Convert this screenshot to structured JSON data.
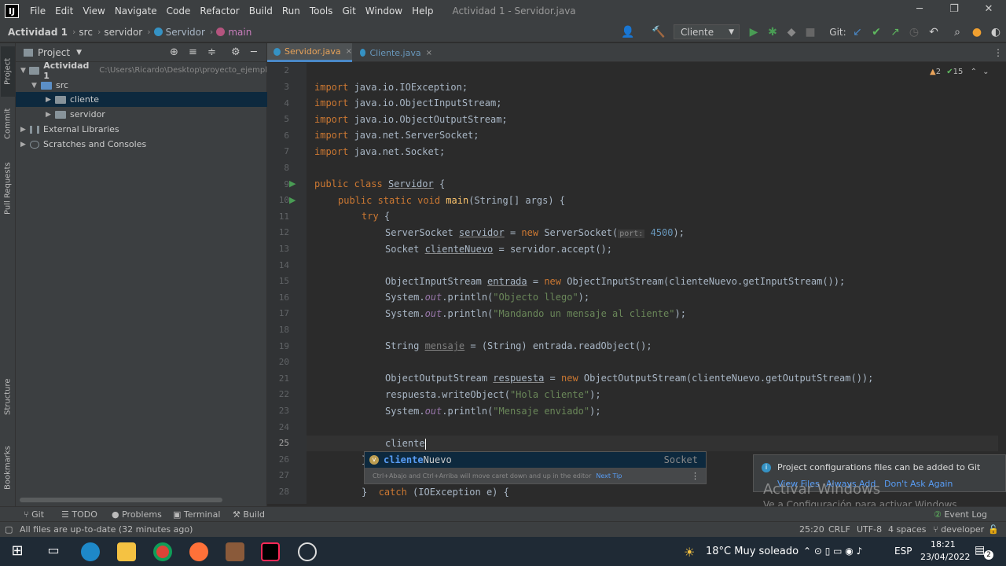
{
  "menubar": {
    "items": [
      "File",
      "Edit",
      "View",
      "Navigate",
      "Code",
      "Refactor",
      "Build",
      "Run",
      "Tools",
      "Git",
      "Window",
      "Help"
    ],
    "title": "Actividad 1 - Servidor.java"
  },
  "breadcrumb": [
    "Actividad 1",
    "src",
    "servidor",
    "Servidor",
    "main"
  ],
  "toolbar": {
    "run_config": "Cliente",
    "git_label": "Git:"
  },
  "left_tools": [
    "Project",
    "Commit",
    "Pull Requests",
    "Structure",
    "Bookmarks"
  ],
  "project": {
    "header": "Project",
    "tree": [
      {
        "label": "Actividad 1",
        "path": "C:\\Users\\Ricardo\\Desktop\\proyecto_ejempl"
      },
      {
        "label": "src"
      },
      {
        "label": "cliente"
      },
      {
        "label": "servidor"
      },
      {
        "label": "External Libraries"
      },
      {
        "label": "Scratches and Consoles"
      }
    ]
  },
  "tabs": [
    "Servidor.java",
    "Cliente.java"
  ],
  "inspections": {
    "warnings": "2",
    "ok": "15"
  },
  "line_numbers": [
    "2",
    "3",
    "4",
    "5",
    "6",
    "7",
    "8",
    "9",
    "10",
    "11",
    "12",
    "13",
    "14",
    "15",
    "16",
    "17",
    "18",
    "19",
    "20",
    "21",
    "22",
    "23",
    "24",
    "25",
    "26",
    "27",
    "28"
  ],
  "code": {
    "l3_kw": "import",
    "l3": " java.io.IOException;",
    "l4_kw": "import",
    "l4": " java.io.ObjectInputStream;",
    "l5_kw": "import",
    "l5": " java.io.ObjectOutputStream;",
    "l6_kw": "import",
    "l6": " java.net.ServerSocket;",
    "l7_kw": "import",
    "l7": " java.net.Socket;",
    "l9_kw": "public class",
    "l9_name": "Servidor",
    "l9": " {",
    "l10_kw": "public static void",
    "l10_fn": "main",
    "l10": "(String[] args) {",
    "l11_kw": "try",
    "l11": " {",
    "l12_a": "ServerSocket ",
    "l12_var": "servidor",
    "l12_b": " = ",
    "l12_new": "new",
    "l12_c": " ServerSocket(",
    "l12_hint": "port:",
    "l12_num": "4500",
    "l12_d": ");",
    "l13_a": "Socket ",
    "l13_var": "clienteNuevo",
    "l13_b": " = servidor.accept();",
    "l15_a": "ObjectInputStream ",
    "l15_var": "entrada",
    "l15_b": " = ",
    "l15_new": "new",
    "l15_c": " ObjectInputStream(clienteNuevo.getInputStream());",
    "l16_a": "System.",
    "l16_out": "out",
    "l16_b": ".println(",
    "l16_str": "\"Objecto llego\"",
    "l16_c": ");",
    "l17_a": "System.",
    "l17_out": "out",
    "l17_b": ".println(",
    "l17_str": "\"Mandando un mensaje al cliente\"",
    "l17_c": ");",
    "l19_a": "String ",
    "l19_var": "mensaje",
    "l19_b": " = (String) entrada.readObject();",
    "l21_a": "ObjectOutputStream ",
    "l21_var": "respuesta",
    "l21_b": " = ",
    "l21_new": "new",
    "l21_c": " ObjectOutputStream(clienteNuevo.getOutputStream());",
    "l22_a": "respuesta.writeObject(",
    "l22_str": "\"Hola cliente\"",
    "l22_b": ");",
    "l23_a": "System.",
    "l23_out": "out",
    "l23_b": ".println(",
    "l23_str": "\"Mensaje enviado\"",
    "l23_c": ");",
    "l25": "cliente",
    "l26": "}",
    "l28_a": "}  ",
    "l28_kw": "catch",
    "l28_b": " (IOException e) {"
  },
  "autocomplete": {
    "match": "cliente",
    "rest": "Nuevo",
    "type": "Socket",
    "hint": "Ctrl+Abajo and Ctrl+Arriba will move caret down and up in the editor",
    "next_tip": "Next Tip"
  },
  "notification": {
    "message": "Project configurations files can be added to Git",
    "view_files": "View Files",
    "always_add": "Always Add",
    "dont_ask": "Don't Ask Again"
  },
  "watermark": {
    "title": "Activar Windows",
    "sub": "Ve a Configuración para activar Windows."
  },
  "bottom_tools": [
    "Git",
    "TODO",
    "Problems",
    "Terminal",
    "Build"
  ],
  "event_log": "Event Log",
  "status": {
    "message": "All files are up-to-date (32 minutes ago)",
    "position": "25:20",
    "line_sep": "CRLF",
    "encoding": "UTF-8",
    "indent": "4 spaces",
    "branch": "developer"
  },
  "taskbar": {
    "weather": "18°C  Muy soleado",
    "lang": "ESP",
    "time": "18:21",
    "date": "23/04/2022",
    "notif_count": "2"
  },
  "colors": {
    "accent": "#4a88c7",
    "keyword": "#cc7832",
    "string": "#6a8759"
  }
}
